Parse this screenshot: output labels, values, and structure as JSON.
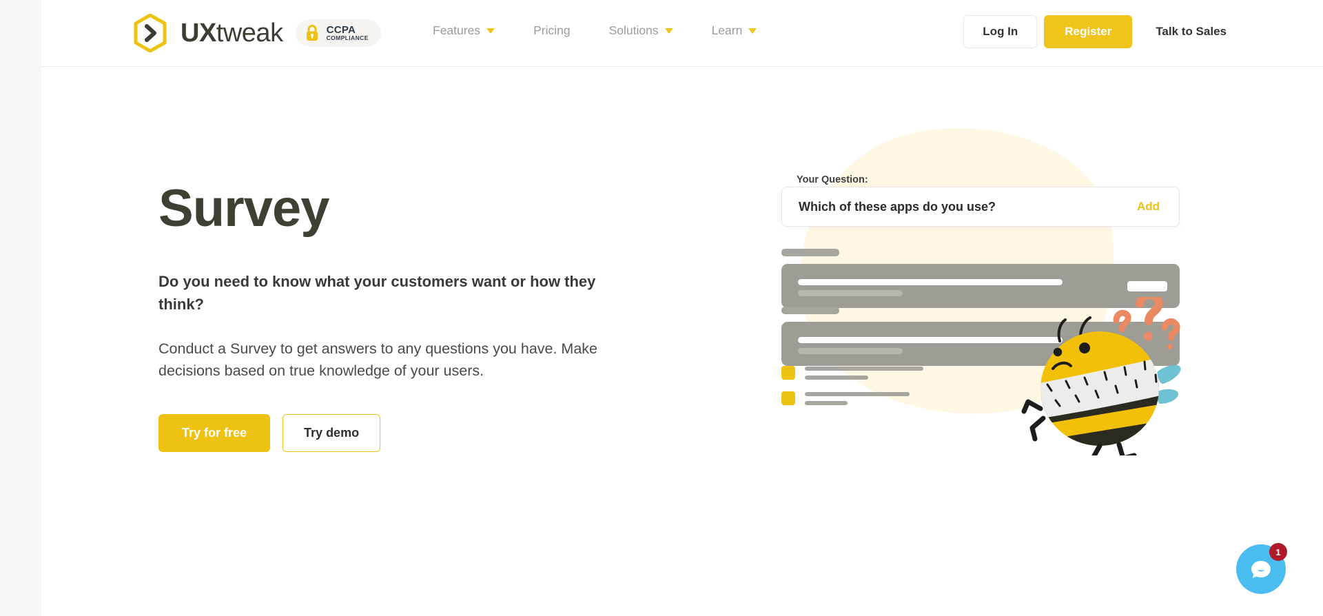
{
  "header": {
    "logo": {
      "mark_icon": "uxtweak-hexagon-chevron-icon",
      "text_bold": "UX",
      "text_light": "tweak"
    },
    "compliance_badge": {
      "lock_icon": "lock-icon",
      "title": "CCPA",
      "subtitle": "COMPLIANCE"
    },
    "nav": [
      {
        "label": "Features",
        "has_dropdown": true
      },
      {
        "label": "Pricing",
        "has_dropdown": false
      },
      {
        "label": "Solutions",
        "has_dropdown": true
      },
      {
        "label": "Learn",
        "has_dropdown": true
      }
    ],
    "actions": {
      "login_label": "Log In",
      "register_label": "Register",
      "sales_label": "Talk to Sales"
    }
  },
  "hero": {
    "title": "Survey",
    "subtitle": "Do you need to know what your customers want or how they think?",
    "body": "Conduct a Survey to get answers to any questions you have. Make decisions based on true knowledge of your users.",
    "primary_cta": "Try for free",
    "secondary_cta": "Try demo"
  },
  "illustration": {
    "question_label": "Your Question:",
    "question_value": "Which of these apps do you use?",
    "add_label": "Add",
    "bee_icon": "bee-mascot-icon",
    "question_marks_icon": "question-marks-icon",
    "blob_color": "#fdf7e3",
    "skeleton_color": "#9d9c95",
    "accent_color": "#edc211"
  },
  "chat": {
    "icon": "chat-bubble-icon",
    "badge_count": "1",
    "color": "#49bdf0",
    "badge_color": "#b01a28"
  }
}
